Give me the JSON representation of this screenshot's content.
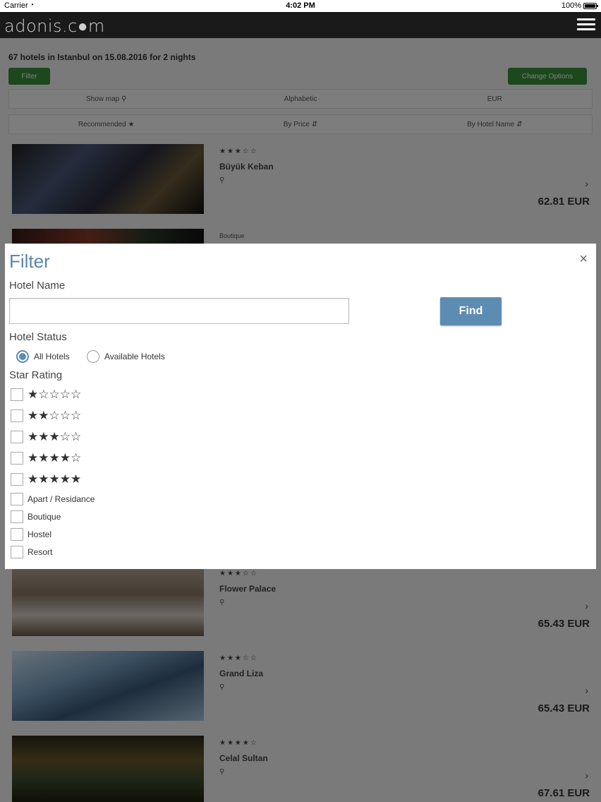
{
  "status_bar": {
    "carrier": "Carrier",
    "time": "4:02 PM",
    "battery": "100%"
  },
  "header": {
    "logo": "adonis.c●m"
  },
  "summary": "67 hotels in Istanbul on 15.08.2016 for 2 nights",
  "buttons": {
    "filter": "Filter",
    "change_options": "Change Options"
  },
  "options_row": {
    "show_map": "Show map ⚲",
    "sort_alpha": "Alphabetic",
    "currency": "EUR"
  },
  "sort_row": {
    "recommended": "Recommended ★",
    "by_price": "By Price ⇵",
    "by_hotel_name": "By Hotel Name ⇵"
  },
  "hotels": [
    {
      "name": "Büyük Keban",
      "stars": "★★★☆☆",
      "location": "⚲",
      "price": "62.81 EUR"
    },
    {
      "tag": "Boutique"
    },
    {
      "name": "Flower Palace",
      "stars": "★★★☆☆",
      "location": "⚲",
      "price": "65.43 EUR"
    },
    {
      "name": "Grand Liza",
      "stars": "★★★☆☆",
      "location": "⚲",
      "price": "65.43 EUR"
    },
    {
      "name": "Celal Sultan",
      "stars": "★★★★☆",
      "location": "⚲",
      "price": "67.61 EUR"
    }
  ],
  "filter_modal": {
    "title": "Filter",
    "close": "×",
    "hotel_name_label": "Hotel Name",
    "hotel_name_value": "",
    "find_button": "Find",
    "hotel_status_label": "Hotel Status",
    "status_options": [
      "All Hotels",
      "Available Hotels"
    ],
    "selected_status": "All Hotels",
    "star_rating_label": "Star Rating",
    "star_options": [
      "★☆☆☆☆",
      "★★☆☆☆",
      "★★★☆☆",
      "★★★★☆",
      "★★★★★"
    ],
    "type_options": [
      "Apart / Residance",
      "Boutique",
      "Hostel",
      "Resort"
    ]
  }
}
